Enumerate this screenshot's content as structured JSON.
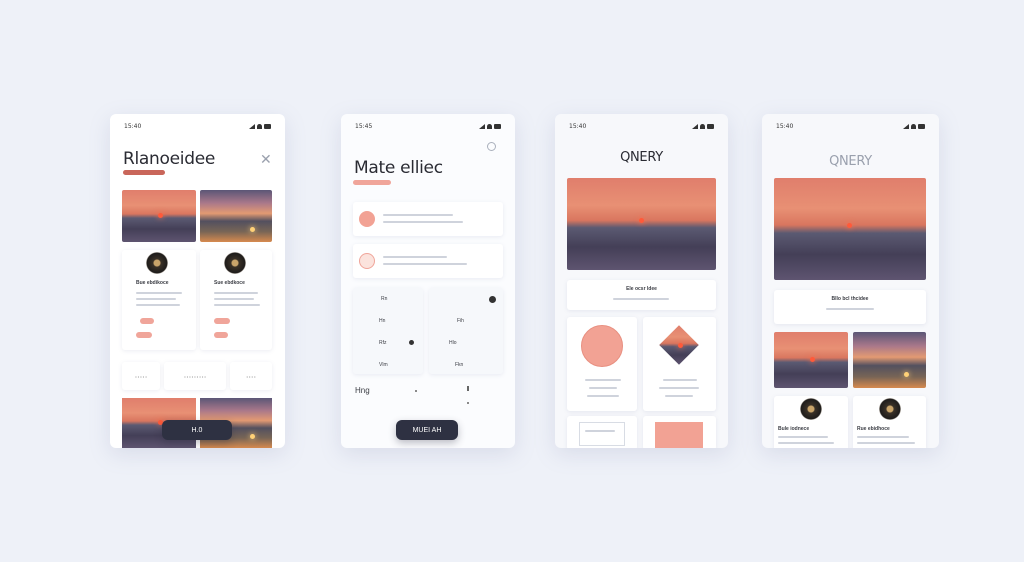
{
  "screens": [
    {
      "time": "15:40",
      "title": "Rlanoeidee",
      "close_label": "✕",
      "cards": [
        {
          "name": "Bue ebdikoce"
        },
        {
          "name": "Sue ebdkoce"
        }
      ],
      "chips": [
        "• • • • •",
        "• • • • • • • • •",
        "• • • •"
      ],
      "button_label": "H.0"
    },
    {
      "time": "15:45",
      "title": "Mate elliec",
      "settings_icon": "gear-icon",
      "grid_labels": [
        "Rn",
        "Hn",
        "Rfz",
        "Vlm",
        "Fih",
        "Hlo",
        "Fkn",
        "Hng"
      ],
      "button_label": "MUEI AH"
    },
    {
      "time": "15:40",
      "title": "QNERY",
      "caption": "Ele ocsr ldee",
      "button_label": ""
    },
    {
      "time": "15:40",
      "title": "QNERY",
      "caption": "Bllo bcl thcidee",
      "cards": [
        {
          "name": "Bule iodnece"
        },
        {
          "name": "Rue ebidhoce"
        }
      ]
    }
  ],
  "colors": {
    "accent": "#c9665a",
    "accent_soft": "#f0a59a",
    "dark_button": "#2e3142",
    "background": "#eef1f8"
  }
}
